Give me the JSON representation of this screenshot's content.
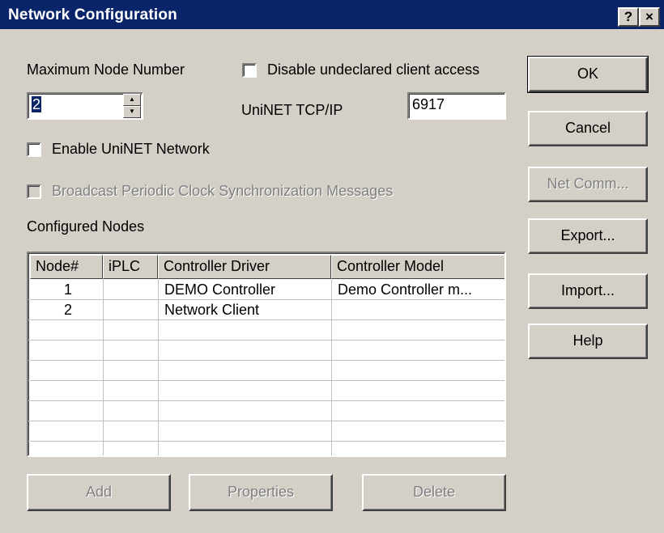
{
  "window": {
    "title": "Network Configuration",
    "help_button": "?",
    "close_button": "×"
  },
  "form": {
    "max_node_label": "Maximum Node Number",
    "max_node_value": "2",
    "disable_undeclared_label": "Disable undeclared client access",
    "disable_undeclared_checked": false,
    "tcpip_label": "UniNET TCP/IP",
    "tcpip_value": "6917",
    "enable_uninet_label": "Enable UniNET Network",
    "enable_uninet_checked": false,
    "broadcast_label": "Broadcast Periodic Clock Synchronization Messages",
    "broadcast_checked": false,
    "configured_nodes_label": "Configured Nodes"
  },
  "table": {
    "columns": [
      "Node#",
      "iPLC",
      "Controller Driver",
      "Controller Model"
    ],
    "rows": [
      {
        "node": "1",
        "iplc": "",
        "driver": "DEMO Controller",
        "model": "Demo Controller m..."
      },
      {
        "node": "2",
        "iplc": "",
        "driver": "Network Client",
        "model": ""
      }
    ]
  },
  "buttons": {
    "ok": "OK",
    "cancel": "Cancel",
    "net_comm": "Net Comm...",
    "export": "Export...",
    "import": "Import...",
    "help": "Help",
    "add": "Add",
    "properties": "Properties",
    "delete": "Delete"
  },
  "colors": {
    "face": "#d4d0c8",
    "titlebar": "#0a246a",
    "disabled_text": "#808080"
  }
}
